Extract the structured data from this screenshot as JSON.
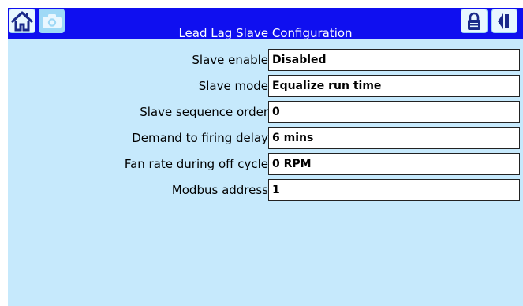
{
  "header": {
    "title": "Lead Lag Slave Configuration",
    "icons": {
      "home": "home-icon",
      "camera": "camera-icon",
      "lock": "lock-icon",
      "back": "back-arrow-icon"
    },
    "colors": {
      "bar": "#0f0ff0",
      "screen": "#c6e9fc"
    }
  },
  "settings": [
    {
      "label": "Slave enable",
      "value": "Disabled"
    },
    {
      "label": "Slave mode",
      "value": "Equalize run time"
    },
    {
      "label": "Slave sequence order",
      "value": "0"
    },
    {
      "label": "Demand to firing delay",
      "value": "6 mins"
    },
    {
      "label": "Fan rate during off cycle",
      "value": "0 RPM"
    },
    {
      "label": "Modbus address",
      "value": "1"
    }
  ]
}
